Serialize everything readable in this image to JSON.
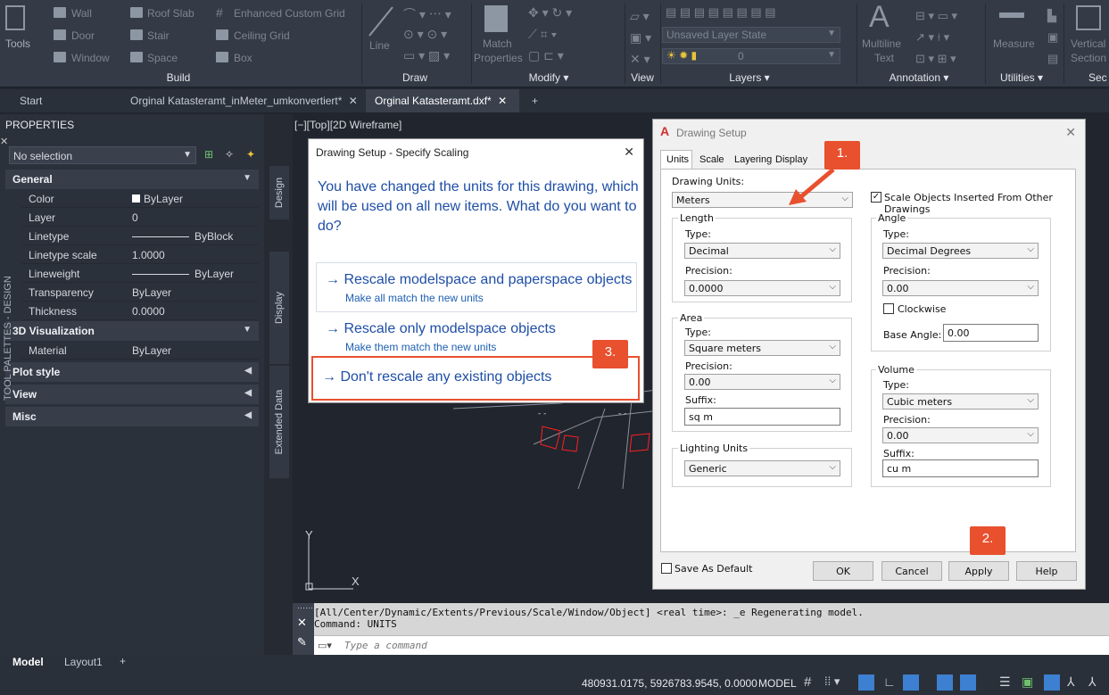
{
  "ribbon": {
    "tools_label": "Tools",
    "build": {
      "wall": "Wall",
      "door": "Door",
      "window": "Window",
      "roof_slab": "Roof Slab",
      "stair": "Stair",
      "space": "Space",
      "enhanced_grid": "Enhanced Custom Grid",
      "ceiling_grid": "Ceiling Grid",
      "box": "Box",
      "panel": "Build"
    },
    "draw": {
      "line": "Line",
      "panel": "Draw"
    },
    "modify": {
      "match": "Match",
      "properties": "Properties",
      "panel": "Modify"
    },
    "view": {
      "panel": "View"
    },
    "layers": {
      "layer_state": "Unsaved Layer State",
      "layer": "0",
      "panel": "Layers"
    },
    "annotation": {
      "multiline": "Multiline",
      "text": "Text",
      "panel": "Annotation"
    },
    "utilities": {
      "measure": "Measure",
      "panel": "Utilities"
    },
    "vertical": {
      "vertical": "Vertical",
      "section": "Section",
      "panel": "Sec"
    }
  },
  "tabs": [
    "Start",
    "Orginal Katasteramt_inMeter_umkonvertiert*",
    "Orginal Katasteramt.dxf*"
  ],
  "properties": {
    "title": "PROPERTIES",
    "selection": "No selection",
    "general": "General",
    "rows": [
      {
        "k": "Color",
        "v": "ByLayer"
      },
      {
        "k": "Layer",
        "v": "0"
      },
      {
        "k": "Linetype",
        "v": "ByBlock"
      },
      {
        "k": "Linetype scale",
        "v": "1.0000"
      },
      {
        "k": "Lineweight",
        "v": "ByLayer"
      },
      {
        "k": "Transparency",
        "v": "ByLayer"
      },
      {
        "k": "Thickness",
        "v": "0.0000"
      }
    ],
    "viz": "3D Visualization",
    "material_k": "Material",
    "material_v": "ByLayer",
    "plot": "Plot style",
    "view": "View",
    "misc": "Misc",
    "palette_label": "TOOL PALETTES - DESIGN",
    "side_tabs": [
      "Design",
      "Display",
      "Extended Data"
    ]
  },
  "viewport": {
    "label": "[−][Top][2D Wireframe]",
    "axis_y": "Y",
    "axis_x": "X"
  },
  "scale_dialog": {
    "title": "Drawing Setup - Specify Scaling",
    "message": "You have changed the units for this drawing, which will be used on all new items. What do you want to do?",
    "options": [
      {
        "main": "Rescale modelspace and paperspace objects",
        "sub": "Make all match the new units"
      },
      {
        "main": "Rescale only modelspace objects",
        "sub": "Make them match the new units"
      },
      {
        "main": "Don't rescale any existing objects",
        "sub": ""
      }
    ]
  },
  "setup_dialog": {
    "title": "Drawing Setup",
    "tabs": [
      "Units",
      "Scale",
      "Layering",
      "Display"
    ],
    "drawing_units_label": "Drawing Units:",
    "drawing_units": "Meters",
    "scale_objects": "Scale Objects Inserted From Other Drawings",
    "length": {
      "title": "Length",
      "type_label": "Type:",
      "type": "Decimal",
      "precision_label": "Precision:",
      "precision": "0.0000"
    },
    "angle": {
      "title": "Angle",
      "type_label": "Type:",
      "type": "Decimal Degrees",
      "precision_label": "Precision:",
      "precision": "0.00",
      "clockwise": "Clockwise",
      "base_label": "Base Angle:",
      "base": "0.00"
    },
    "area": {
      "title": "Area",
      "type_label": "Type:",
      "type": "Square meters",
      "precision_label": "Precision:",
      "precision": "0.00",
      "suffix_label": "Suffix:",
      "suffix": "sq m"
    },
    "volume": {
      "title": "Volume",
      "type_label": "Type:",
      "type": "Cubic meters",
      "precision_label": "Precision:",
      "precision": "0.00",
      "suffix_label": "Suffix:",
      "suffix": "cu m"
    },
    "lighting": {
      "title": "Lighting Units",
      "value": "Generic"
    },
    "save_default": "Save As Default",
    "buttons": {
      "ok": "OK",
      "cancel": "Cancel",
      "apply": "Apply",
      "help": "Help"
    }
  },
  "annotations": {
    "b1": "1.",
    "b2": "2.",
    "b3": "3."
  },
  "command": {
    "history1": "[All/Center/Dynamic/Extents/Previous/Scale/Window/Object] <real time>: _e Regenerating model.",
    "history2": "Command: UNITS",
    "placeholder": "Type a command"
  },
  "layouts": {
    "model": "Model",
    "layout1": "Layout1"
  },
  "status": {
    "coords": "480931.0175, 5926783.9545, 0.0000",
    "model": "MODEL"
  },
  "colors": {
    "accent": "#e8502e",
    "link": "#1e4ea6",
    "drawing_red": "#ff2020"
  }
}
